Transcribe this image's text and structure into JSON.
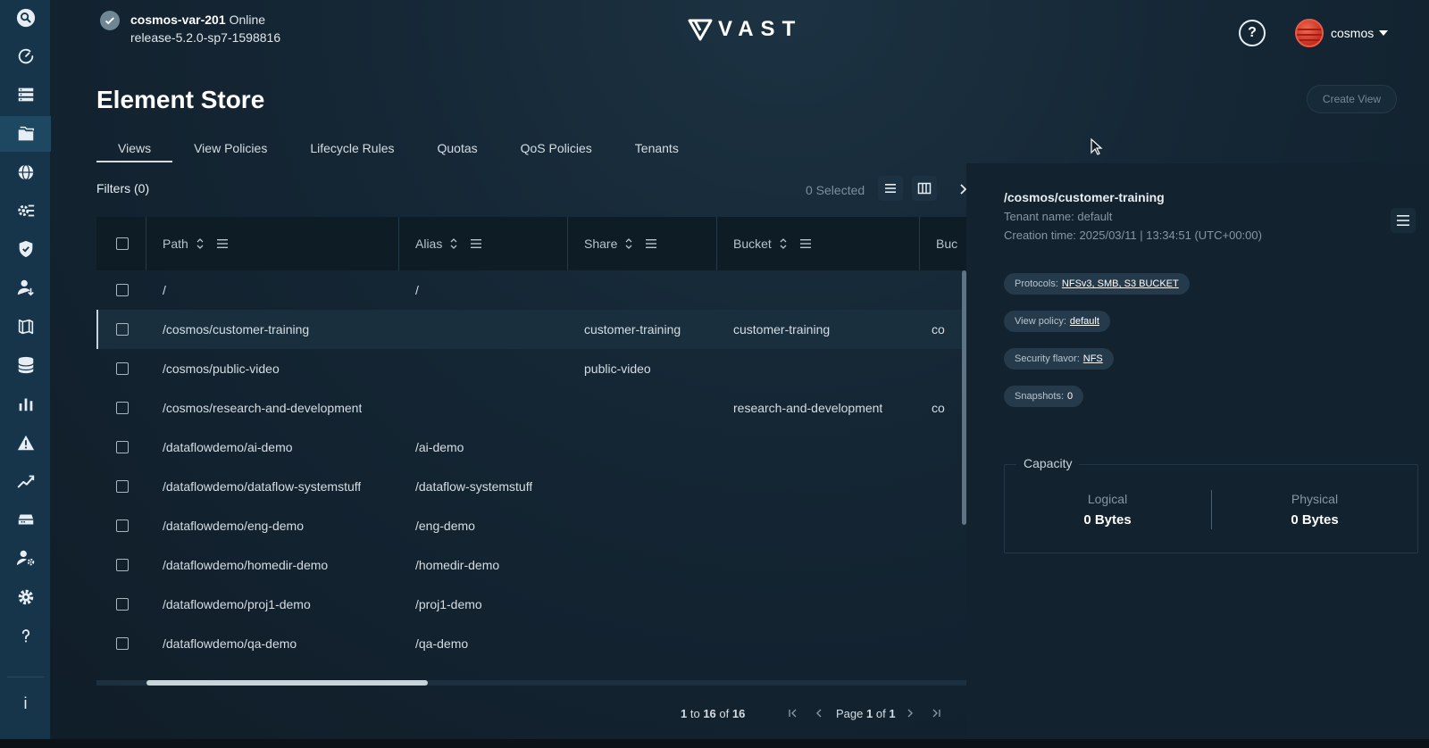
{
  "header": {
    "system_name": "cosmos-var-201",
    "system_status": "Online",
    "release": "release-5.2.0-sp7-1598816",
    "logo_text": "VAST",
    "user": "cosmos"
  },
  "page": {
    "title": "Element Store",
    "create_button": "Create View"
  },
  "tabs": [
    {
      "label": "Views",
      "active": true
    },
    {
      "label": "View Policies"
    },
    {
      "label": "Lifecycle Rules"
    },
    {
      "label": "Quotas"
    },
    {
      "label": "QoS Policies"
    },
    {
      "label": "Tenants"
    }
  ],
  "toolbar": {
    "filters": "Filters (0)",
    "selected": "0 Selected"
  },
  "table": {
    "columns": [
      "Path",
      "Alias",
      "Share",
      "Bucket",
      "Buc"
    ],
    "rows": [
      {
        "path": "/",
        "alias": "/",
        "share": "",
        "bucket": "",
        "extra": ""
      },
      {
        "path": "/cosmos/customer-training",
        "alias": "",
        "share": "customer-training",
        "bucket": "customer-training",
        "extra": "co"
      },
      {
        "path": "/cosmos/public-video",
        "alias": "",
        "share": "public-video",
        "bucket": "",
        "extra": ""
      },
      {
        "path": "/cosmos/research-and-development",
        "alias": "",
        "share": "",
        "bucket": "research-and-development",
        "extra": "co"
      },
      {
        "path": "/dataflowdemo/ai-demo",
        "alias": "/ai-demo",
        "share": "",
        "bucket": "",
        "extra": ""
      },
      {
        "path": "/dataflowdemo/dataflow-systemstuff",
        "alias": "/dataflow-systemstuff",
        "share": "",
        "bucket": "",
        "extra": ""
      },
      {
        "path": "/dataflowdemo/eng-demo",
        "alias": "/eng-demo",
        "share": "",
        "bucket": "",
        "extra": ""
      },
      {
        "path": "/dataflowdemo/homedir-demo",
        "alias": "/homedir-demo",
        "share": "",
        "bucket": "",
        "extra": ""
      },
      {
        "path": "/dataflowdemo/proj1-demo",
        "alias": "/proj1-demo",
        "share": "",
        "bucket": "",
        "extra": ""
      },
      {
        "path": "/dataflowdemo/qa-demo",
        "alias": "/qa-demo",
        "share": "",
        "bucket": "",
        "extra": ""
      }
    ]
  },
  "pager": {
    "from": "1",
    "to_word": "to",
    "to": "16",
    "of_word": "of",
    "total": "16",
    "page_word": "Page",
    "page": "1",
    "page_of_word": "of",
    "pages": "1"
  },
  "detail": {
    "path": "/cosmos/customer-training",
    "tenant": "Tenant name: default",
    "created": "Creation time: 2025/03/11 | 13:34:51 (UTC+00:00)",
    "protocols_label": "Protocols:",
    "protocols_value": "NFSv3, SMB, S3 BUCKET",
    "view_policy_label": "View policy:",
    "view_policy_value": "default",
    "security_label": "Security flavor:",
    "security_value": "NFS",
    "snapshots_label": "Snapshots:",
    "snapshots_value": "0",
    "capacity_title": "Capacity",
    "logical_label": "Logical",
    "logical_value": "0 Bytes",
    "physical_label": "Physical",
    "physical_value": "0 Bytes"
  },
  "sidebar": {
    "items": [
      "search-icon",
      "dashboard-icon",
      "infrastructure-icon",
      "element-store-icon",
      "network-icon",
      "services-icon",
      "security-icon",
      "user-management-icon",
      "data-protection-icon",
      "database-icon",
      "analytics-icon",
      "alerts-icon",
      "trends-icon",
      "hardware-icon",
      "admin-icon",
      "settings-icon",
      "help-icon",
      "info-icon"
    ],
    "info_label": "i"
  },
  "colors": {
    "sidebar_bg": "#16354a",
    "page_bg": "#142533",
    "panel_bg": "#12222e",
    "accent_white": "#ffffff"
  }
}
